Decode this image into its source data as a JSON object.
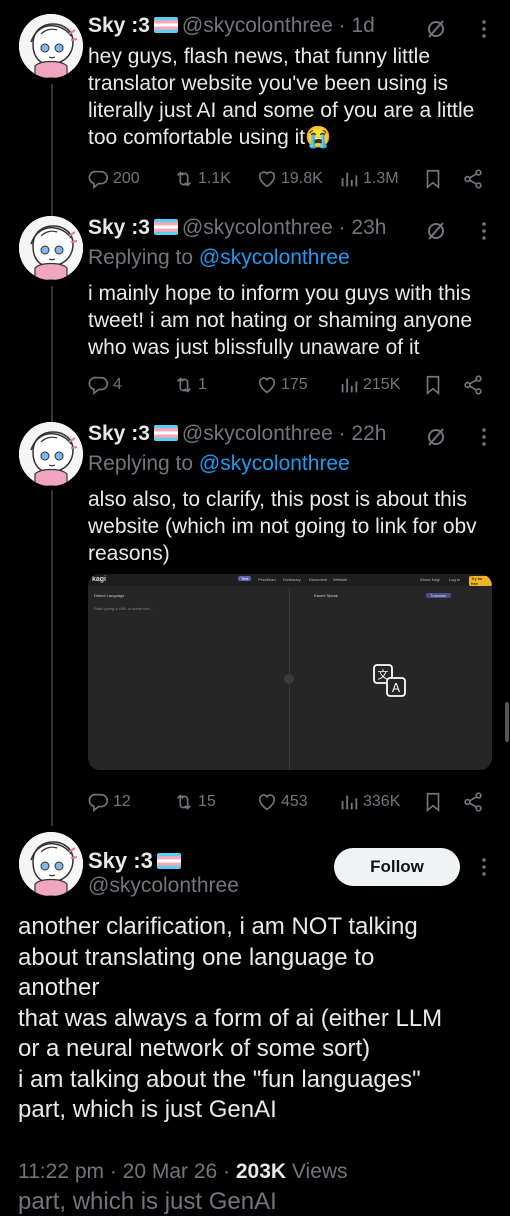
{
  "tweets": [
    {
      "name": "Sky :3",
      "handle": "@skycolonthree",
      "time": "· 1d",
      "text": "hey guys, flash news, that funny little translator website you've been using is literally just AI and some of you are a little too comfortable using it😭",
      "stats": {
        "replies": "200",
        "retweets": "1.1K",
        "likes": "19.8K",
        "views": "1.3M"
      }
    },
    {
      "name": "Sky :3",
      "handle": "@skycolonthree",
      "time": "· 23h",
      "reply_label": "Replying to",
      "reply_handle": "@skycolonthree",
      "text": "i mainly hope to inform you guys with this tweet! i am not hating or shaming anyone who was just blissfully unaware of it",
      "stats": {
        "replies": "4",
        "retweets": "1",
        "likes": "175",
        "views": "215K"
      }
    },
    {
      "name": "Sky :3",
      "handle": "@skycolonthree",
      "time": "· 22h",
      "reply_label": "Replying to",
      "reply_handle": "@skycolonthree",
      "text": "also also, to clarify, this post is about this website (which im not going to link for obv reasons)",
      "media": {
        "logo": "kagi",
        "source_lang": "Detect Language",
        "target_lang": "Kaomi Speak",
        "placeholder": "Start typing a URL or some text...",
        "translate_btn": "Translate",
        "about": "About Kagi",
        "login": "Log in",
        "signup": "Try for free",
        "tabs": [
          "Text",
          "Proofread",
          "Dictionary",
          "Document",
          "Website"
        ]
      },
      "stats": {
        "replies": "12",
        "retweets": "15",
        "likes": "453",
        "views": "336K"
      }
    }
  ],
  "main": {
    "name": "Sky :3",
    "handle": "@skycolonthree",
    "follow_label": "Follow",
    "lines": [
      "another clarification, i am NOT talking",
      "about translating one language to",
      "another",
      "that was always a form of ai (either LLM",
      "or a neural network of some sort)",
      "i am talking about the \"fun languages\"",
      "part, which is just GenAI"
    ],
    "time": "11:22 pm · 20 Mar 26 · ",
    "views_count": "203K",
    "views_label": " Views",
    "ghost_text": "part, which is just GenAI"
  },
  "colors": {
    "accent": "#1d9bf0",
    "muted": "#71767b",
    "text": "#e7e9ea",
    "bg": "#000000"
  }
}
